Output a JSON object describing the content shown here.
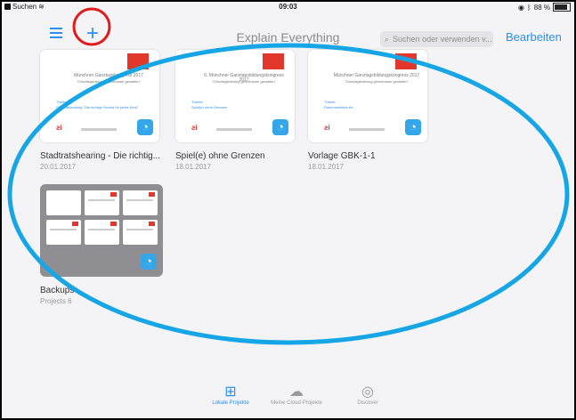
{
  "status_bar": {
    "back_label": "Suchen",
    "time": "09:03",
    "battery": "88 %",
    "battery_level": 0.88
  },
  "nav": {
    "title": "Explain Everything",
    "search_placeholder": "Suchen oder verwenden v...",
    "edit_label": "Bearbeiten",
    "menu_icon": "hamburger-menu-icon",
    "add_icon": "plus-icon"
  },
  "projects": [
    {
      "title": "Stadtratshearing - Die richtig...",
      "date": "20.01.2017",
      "slide_heading": "Münchner Ganztagskongress 2017",
      "slide_subheading": "\"Ganztagsbildung gemeinsam gestalten\"",
      "slide_theme_label": "Thema",
      "slide_theme": "Stadtratshearing \"Die richtige Schule für jedes Kind\""
    },
    {
      "title": "Spiel(e) ohne Grenzen",
      "date": "18.01.2017",
      "slide_heading": "6. Münchner Ganztagsbildungskongress 2017",
      "slide_subheading": "\"Ganztagsbildung gemeinsam gestalten\"",
      "slide_theme_label": "Thema",
      "slide_theme": "Spiel(e) ohne Grenzen"
    },
    {
      "title": "Vorlage GBK-1-1",
      "date": "18.01.2017",
      "slide_heading": "Münchner Ganztagsbildungskongress 2017",
      "slide_subheading": "\"Ganztagsbildung gemeinsam gestalten\"",
      "slide_theme_label": "Thema",
      "slide_theme": "Dokumentation für"
    }
  ],
  "folder": {
    "title": "Backups",
    "subtitle": "Projects 6"
  },
  "tabs": [
    {
      "label": "Lokale Projekte",
      "icon": "grid-icon",
      "active": true
    },
    {
      "label": "Meine Cloud-Projekte",
      "icon": "cloud-icon",
      "active": false
    },
    {
      "label": "Discover",
      "icon": "eye-icon",
      "active": false
    }
  ],
  "colors": {
    "accent": "#2a8ff0",
    "annotation_red": "#e01b1b",
    "annotation_cyan": "#16a6e6"
  }
}
